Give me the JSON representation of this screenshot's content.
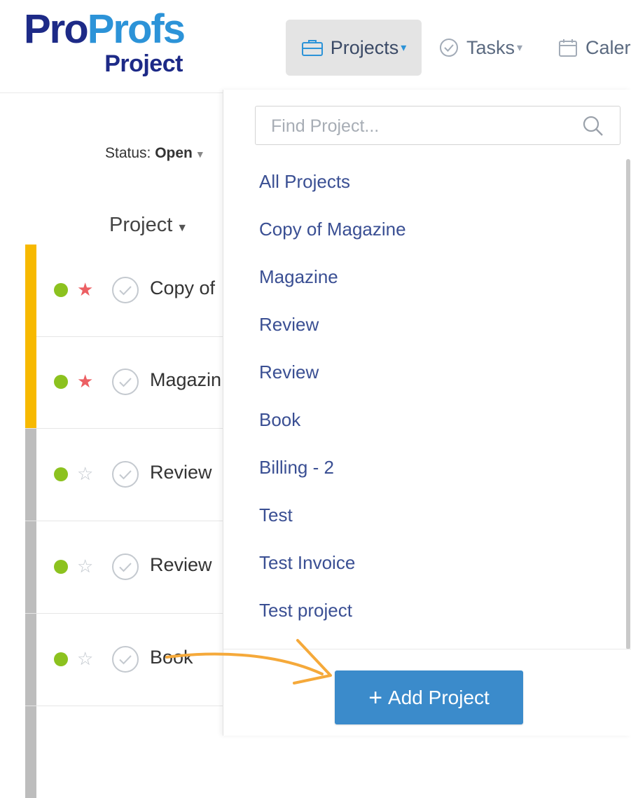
{
  "logo": {
    "pro": "Pro",
    "profs": "Profs",
    "sub": "Project"
  },
  "nav": {
    "projects": "Projects",
    "tasks": "Tasks",
    "calendar": "Caler"
  },
  "filter": {
    "label": "Status:",
    "value": "Open"
  },
  "table": {
    "column_header": "Project",
    "rows": [
      {
        "name": "Copy of",
        "starred": true,
        "bar_color": "#f7b900"
      },
      {
        "name": "Magazin",
        "starred": true,
        "bar_color": "#f7b900"
      },
      {
        "name": "Review",
        "starred": false,
        "bar_color": "#bdbdbd"
      },
      {
        "name": "Review",
        "starred": false,
        "bar_color": "#bdbdbd"
      },
      {
        "name": "Book",
        "starred": false,
        "bar_color": "#bdbdbd"
      }
    ]
  },
  "dropdown": {
    "search_placeholder": "Find Project...",
    "items": [
      "All Projects",
      "Copy of Magazine",
      "Magazine",
      "Review",
      "Review",
      "Book",
      "Billing - 2",
      "Test",
      "Test Invoice",
      "Test project"
    ],
    "add_button": "Add Project"
  },
  "colors": {
    "brand_dark": "#1d2a87",
    "brand_light": "#2c93d8",
    "link": "#3a4f93",
    "button": "#3b8bcb",
    "arrow": "#f5a93a",
    "status_dot": "#8cc21f",
    "star": "#ec5f63"
  }
}
